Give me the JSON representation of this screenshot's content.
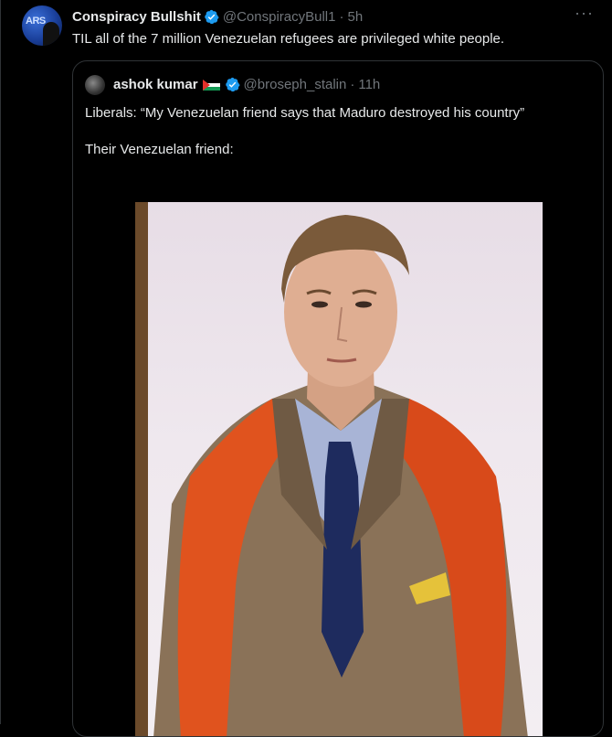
{
  "tweet": {
    "author_name": "Conspiracy Bullshit",
    "author_handle": "@ConspiracyBull1",
    "separator": "·",
    "time": "5h",
    "more_label": "···",
    "avatar_text": "ARS",
    "text": "TIL all of the 7 million Venezuelan refugees are privileged white people."
  },
  "quote": {
    "author_name": "ashok kumar",
    "author_handle": "@broseph_stalin",
    "separator": "·",
    "time": "11h",
    "text": "Liberals: “My Venezuelan friend says that Maduro destroyed his country”\n\nTheir Venezuelan friend:"
  },
  "colors": {
    "background": "#000000",
    "verified": "#1d9bf0",
    "muted_text": "#71767b",
    "border": "#2f3336"
  }
}
